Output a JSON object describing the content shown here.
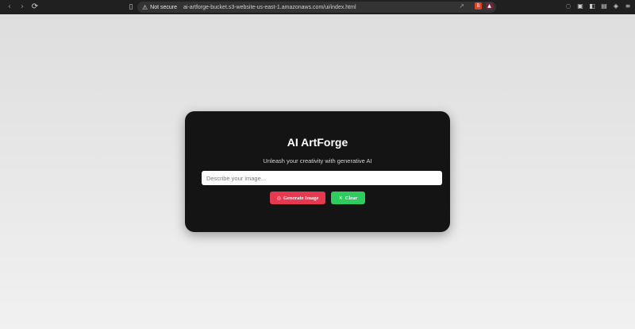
{
  "browser": {
    "address_bar": {
      "security_label": "Not secure",
      "url": "ai-artforge-bucket.s3-website-us-east-1.amazonaws.com/ui/index.html"
    },
    "icons": {
      "back": "‹",
      "forward": "›",
      "reload": "⟳",
      "bookmark": "▯",
      "warning": "⚠",
      "share": "↗",
      "brave_shield": "B",
      "rewards": "▲",
      "chat": "◌",
      "screenshot": "▣",
      "sidebar": "◧",
      "wallet": "▤",
      "vpn": "◈",
      "menu": "≡"
    }
  },
  "app": {
    "title": "AI ArtForge",
    "subtitle": "Unleash your creativity with generative AI",
    "prompt": {
      "placeholder": "Describe your image...",
      "value": ""
    },
    "buttons": {
      "generate_icon": "◎",
      "generate_label": "Generate Image",
      "clear_icon": "✕",
      "clear_label": "Clear"
    }
  },
  "colors": {
    "card_bg": "#141414",
    "generate": "#e63950",
    "clear": "#2ecc5f",
    "page_bg": "#eaeaea"
  }
}
